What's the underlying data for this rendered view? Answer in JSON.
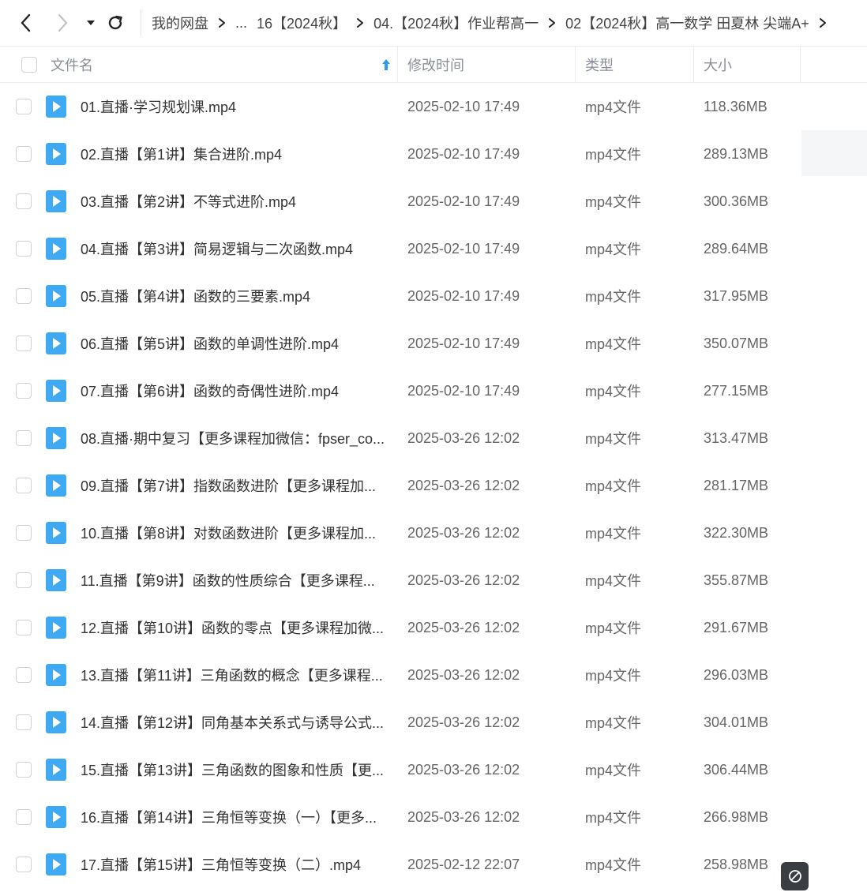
{
  "toolbar": {
    "back_icon": "chevron-left-icon",
    "forward_icon": "chevron-right-icon",
    "history_icon": "caret-down-icon",
    "refresh_icon": "refresh-icon"
  },
  "breadcrumb": [
    "我的网盘",
    "...",
    "16【2024秋】",
    "04.【2024秋】作业帮高一",
    "02【2024秋】高一数学 田夏林 尖端A+"
  ],
  "header": {
    "name": "文件名",
    "modified": "修改时间",
    "type": "类型",
    "size": "大小",
    "sort_icon": "arrow-up-icon"
  },
  "files": [
    {
      "name": "01.直播·学习规划课.mp4",
      "date": "2025-02-10 17:49",
      "type": "mp4文件",
      "size": "118.36MB"
    },
    {
      "name": "02.直播【第1讲】集合进阶.mp4",
      "date": "2025-02-10 17:49",
      "type": "mp4文件",
      "size": "289.13MB"
    },
    {
      "name": "03.直播【第2讲】不等式进阶.mp4",
      "date": "2025-02-10 17:49",
      "type": "mp4文件",
      "size": "300.36MB"
    },
    {
      "name": "04.直播【第3讲】简易逻辑与二次函数.mp4",
      "date": "2025-02-10 17:49",
      "type": "mp4文件",
      "size": "289.64MB"
    },
    {
      "name": "05.直播【第4讲】函数的三要素.mp4",
      "date": "2025-02-10 17:49",
      "type": "mp4文件",
      "size": "317.95MB"
    },
    {
      "name": "06.直播【第5讲】函数的单调性进阶.mp4",
      "date": "2025-02-10 17:49",
      "type": "mp4文件",
      "size": "350.07MB"
    },
    {
      "name": "07.直播【第6讲】函数的奇偶性进阶.mp4",
      "date": "2025-02-10 17:49",
      "type": "mp4文件",
      "size": "277.15MB"
    },
    {
      "name": "08.直播·期中复习【更多课程加微信：fpser_co...",
      "date": "2025-03-26 12:02",
      "type": "mp4文件",
      "size": "313.47MB"
    },
    {
      "name": "09.直播【第7讲】指数函数进阶【更多课程加...",
      "date": "2025-03-26 12:02",
      "type": "mp4文件",
      "size": "281.17MB"
    },
    {
      "name": "10.直播【第8讲】对数函数进阶【更多课程加...",
      "date": "2025-03-26 12:02",
      "type": "mp4文件",
      "size": "322.30MB"
    },
    {
      "name": "11.直播【第9讲】函数的性质综合【更多课程...",
      "date": "2025-03-26 12:02",
      "type": "mp4文件",
      "size": "355.87MB"
    },
    {
      "name": "12.直播【第10讲】函数的零点【更多课程加微...",
      "date": "2025-03-26 12:02",
      "type": "mp4文件",
      "size": "291.67MB"
    },
    {
      "name": "13.直播【第11讲】三角函数的概念【更多课程...",
      "date": "2025-03-26 12:02",
      "type": "mp4文件",
      "size": "296.03MB"
    },
    {
      "name": "14.直播【第12讲】同角基本关系式与诱导公式...",
      "date": "2025-03-26 12:02",
      "type": "mp4文件",
      "size": "304.01MB"
    },
    {
      "name": "15.直播【第13讲】三角函数的图象和性质【更...",
      "date": "2025-03-26 12:02",
      "type": "mp4文件",
      "size": "306.44MB"
    },
    {
      "name": "16.直播【第14讲】三角恒等变换（一）【更多...",
      "date": "2025-03-26 12:02",
      "type": "mp4文件",
      "size": "266.98MB"
    },
    {
      "name": "17.直播【第15讲】三角恒等变换（二）.mp4",
      "date": "2025-02-12 22:07",
      "type": "mp4文件",
      "size": "258.98MB"
    }
  ],
  "file_icon": "video-file-icon",
  "floating_button_icon": "no-entry-icon",
  "colors": {
    "accent": "#2d9bf0",
    "file_icon": "#40a9f3",
    "muted_text": "#8a8f99"
  }
}
